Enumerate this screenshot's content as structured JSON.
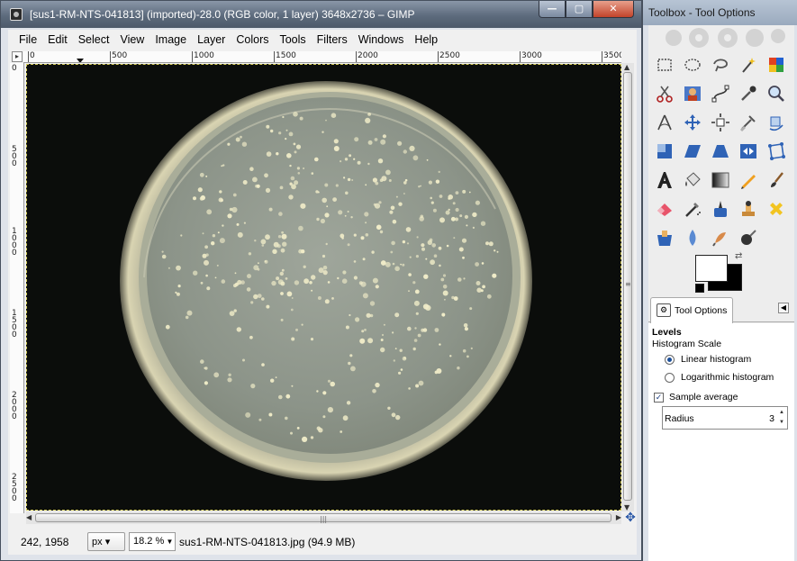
{
  "main_window": {
    "title": "[sus1-RM-NTS-041813] (imported)-28.0 (RGB color, 1 layer) 3648x2736 – GIMP",
    "controls": {
      "minimize": "—",
      "maximize": "▢",
      "close": "✕"
    }
  },
  "menu": [
    "File",
    "Edit",
    "Select",
    "View",
    "Image",
    "Layer",
    "Colors",
    "Tools",
    "Filters",
    "Windows",
    "Help"
  ],
  "rulers": {
    "horizontal_labels": [
      "0",
      "500",
      "1000",
      "1500",
      "2000",
      "2500",
      "3000",
      "3500"
    ],
    "vertical_labels": [
      "0",
      "500",
      "1000",
      "1500",
      "2000",
      "2500"
    ]
  },
  "statusbar": {
    "coords": "242, 1958",
    "unit": "px",
    "zoom": "18.2 %",
    "file_info": "sus1-RM-NTS-041813.jpg (94.9 MB)"
  },
  "toolbox": {
    "title": "Toolbox - Tool Options",
    "tools": [
      "rect-select",
      "ellipse-select",
      "free-select",
      "fuzzy-select",
      "by-color-select",
      "scissors-select",
      "foreground-select",
      "paths",
      "color-picker",
      "zoom",
      "measure",
      "move",
      "align",
      "crop",
      "rotate",
      "scale",
      "shear",
      "perspective",
      "flip",
      "cage-transform",
      "text",
      "bucket-fill",
      "blend",
      "pencil",
      "paintbrush",
      "eraser",
      "airbrush",
      "ink",
      "clone",
      "heal",
      "perspective-clone",
      "blur",
      "smudge",
      "dodge-burn"
    ],
    "fg_color": "#ffffff",
    "bg_color": "#000000",
    "tab_label": "Tool Options",
    "options": {
      "heading": "Levels",
      "histogram_scale_label": "Histogram Scale",
      "linear_label": "Linear histogram",
      "log_label": "Logarithmic histogram",
      "sample_average_label": "Sample average",
      "radius_label": "Radius",
      "radius_value": "3"
    }
  }
}
